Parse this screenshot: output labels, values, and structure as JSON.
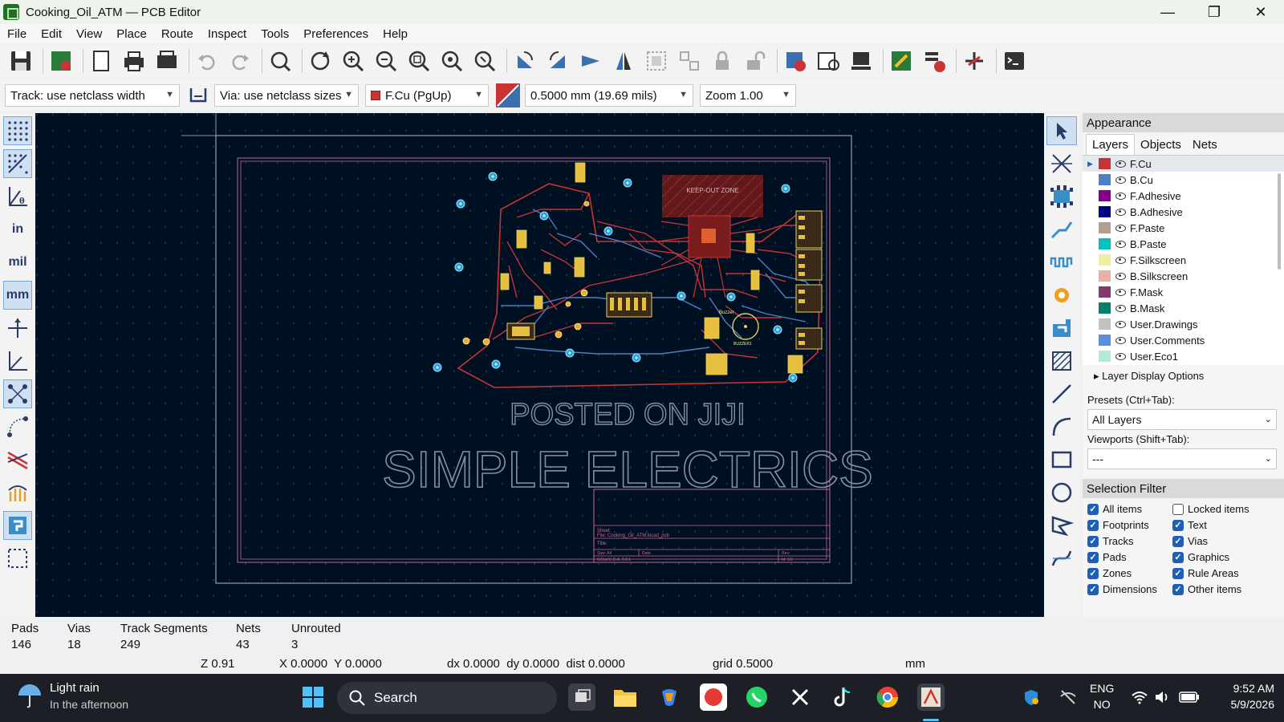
{
  "window": {
    "title": "Cooking_Oil_ATM — PCB Editor",
    "minimize": "—",
    "maximize": "❐",
    "close": "✕"
  },
  "menu": [
    "File",
    "Edit",
    "View",
    "Place",
    "Route",
    "Inspect",
    "Tools",
    "Preferences",
    "Help"
  ],
  "controls": {
    "track": "Track: use netclass width",
    "via": "Via: use netclass sizes",
    "layer": "F.Cu (PgUp)",
    "grid": "0.5000 mm (19.69 mils)",
    "zoom": "Zoom 1.00"
  },
  "left_tools": {
    "units_in": "in",
    "units_mil": "mil",
    "units_mm": "mm"
  },
  "board": {
    "keepout": "KEEP-OUT ZONE",
    "watermark1": "POSTED ON JIJI",
    "watermark2": "SIMPLE ELECTRICS",
    "titleblock": {
      "sheet": "Sheet:",
      "file": "File: Cooking_Oil_ATM.kicad_pcb",
      "title": "Title:",
      "size": "Size: A4",
      "date": "Date:",
      "rev": "Rev:",
      "kicad": "KiCad E.D.A. 9.0.1",
      "id": "Id: 1/1"
    },
    "labels": {
      "buzzer": "Buzzer",
      "buzzer1": "BUZZER1"
    }
  },
  "appearance": {
    "title": "Appearance",
    "tabs": [
      "Layers",
      "Objects",
      "Nets"
    ],
    "layers": [
      {
        "name": "F.Cu",
        "color": "#c83434"
      },
      {
        "name": "B.Cu",
        "color": "#4d7fc4"
      },
      {
        "name": "F.Adhesive",
        "color": "#84008a"
      },
      {
        "name": "B.Adhesive",
        "color": "#000085"
      },
      {
        "name": "F.Paste",
        "color": "#b49d92"
      },
      {
        "name": "B.Paste",
        "color": "#00c2c2"
      },
      {
        "name": "F.Silkscreen",
        "color": "#f2eda1"
      },
      {
        "name": "B.Silkscreen",
        "color": "#e8b2a7"
      },
      {
        "name": "F.Mask",
        "color": "#843a6a"
      },
      {
        "name": "B.Mask",
        "color": "#02806f"
      },
      {
        "name": "User.Drawings",
        "color": "#c2c2c2"
      },
      {
        "name": "User.Comments",
        "color": "#598ee0"
      },
      {
        "name": "User.Eco1",
        "color": "#b5ebd5"
      }
    ],
    "layer_display_options": "Layer Display Options",
    "presets_label": "Presets (Ctrl+Tab):",
    "presets_value": "All Layers",
    "viewports_label": "Viewports (Shift+Tab):",
    "viewports_value": "---"
  },
  "selection_filter": {
    "title": "Selection Filter",
    "items": [
      {
        "label": "All items",
        "checked": true
      },
      {
        "label": "Locked items",
        "checked": false
      },
      {
        "label": "Footprints",
        "checked": true
      },
      {
        "label": "Text",
        "checked": true
      },
      {
        "label": "Tracks",
        "checked": true
      },
      {
        "label": "Vias",
        "checked": true
      },
      {
        "label": "Pads",
        "checked": true
      },
      {
        "label": "Graphics",
        "checked": true
      },
      {
        "label": "Zones",
        "checked": true
      },
      {
        "label": "Rule Areas",
        "checked": true
      },
      {
        "label": "Dimensions",
        "checked": true
      },
      {
        "label": "Other items",
        "checked": true
      }
    ]
  },
  "stats": {
    "pads_label": "Pads",
    "pads": "146",
    "vias_label": "Vias",
    "vias": "18",
    "tracks_label": "Track Segments",
    "tracks": "249",
    "nets_label": "Nets",
    "nets": "43",
    "unrouted_label": "Unrouted",
    "unrouted": "3"
  },
  "coords": {
    "z": "Z 0.91",
    "xy": "X 0.0000  Y 0.0000",
    "delta": "dx 0.0000  dy 0.0000  dist 0.0000",
    "grid": "grid 0.5000",
    "units": "mm"
  },
  "taskbar": {
    "weather_title": "Light rain",
    "weather_sub": "In the afternoon",
    "search": "Search",
    "lang1": "ENG",
    "lang2": "NO",
    "time": "9:52 AM",
    "date": "5/9/2026"
  }
}
